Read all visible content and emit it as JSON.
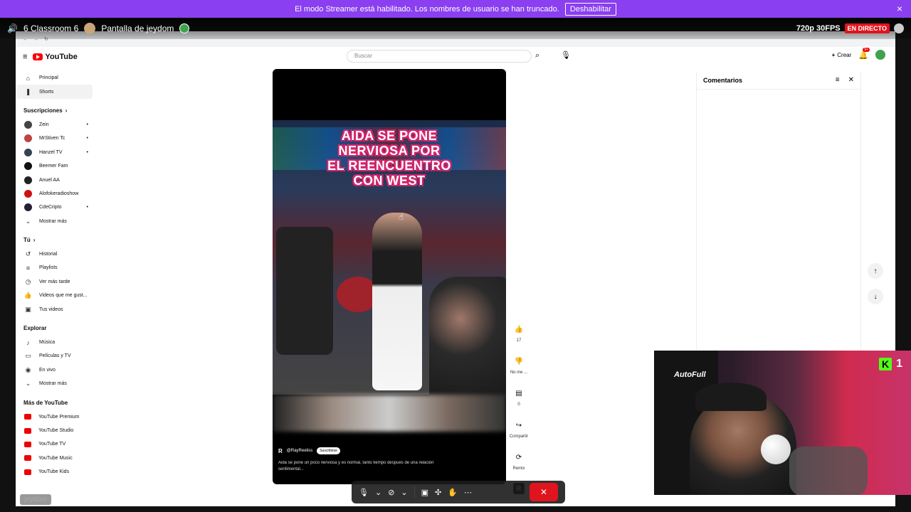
{
  "banner": {
    "message": "El modo Streamer está habilitado. Los nombres de usuario se han truncado.",
    "disable_label": "Deshabilitar",
    "close_icon": "×"
  },
  "stream": {
    "room": "6 Classroom 6",
    "screen_title": "Pantalla de jeydom",
    "quality": "720p 30FPS",
    "live_label": "EN DIRECTO"
  },
  "youtube": {
    "logo_text": "YouTube",
    "search_placeholder": "Buscar",
    "create_label": "Crear",
    "notif_count": "9+",
    "sidebar": {
      "top": [
        {
          "label": "Principal",
          "icon": "⌂"
        },
        {
          "label": "Shorts",
          "icon": "❚"
        }
      ],
      "subs_header": "Suscripciones",
      "subscriptions": [
        {
          "label": "Zein",
          "color": "#444"
        },
        {
          "label": "MrStiven Tc",
          "color": "#b44"
        },
        {
          "label": "Hanzel TV",
          "color": "#345"
        },
        {
          "label": "Beemer Fam",
          "color": "#111"
        },
        {
          "label": "Anuel AA",
          "color": "#222"
        },
        {
          "label": "Alofokeradioshow",
          "color": "#c11"
        },
        {
          "label": "CdeCripto",
          "color": "#223"
        }
      ],
      "show_more": "Mostrar más",
      "you_header": "Tú",
      "you_items": [
        {
          "label": "Historial",
          "icon": "↺"
        },
        {
          "label": "Playlists",
          "icon": "≡"
        },
        {
          "label": "Ver más tarde",
          "icon": "◷"
        },
        {
          "label": "Videos que me gust...",
          "icon": "👍"
        },
        {
          "label": "Tus videos",
          "icon": "▣"
        }
      ],
      "explore_header": "Explorar",
      "explore_items": [
        {
          "label": "Música",
          "icon": "♪"
        },
        {
          "label": "Películas y TV",
          "icon": "▭"
        },
        {
          "label": "En vivo",
          "icon": "◉"
        },
        {
          "label": "Mostrar más",
          "icon": "⌄"
        }
      ],
      "more_header": "Más de YouTube",
      "more_items": [
        {
          "label": "YouTube Premium"
        },
        {
          "label": "YouTube Studio"
        },
        {
          "label": "YouTube TV"
        },
        {
          "label": "YouTube Music"
        },
        {
          "label": "YouTube Kids"
        }
      ]
    },
    "short": {
      "overlay_lines": [
        "AIDA SE PONE",
        "NERVIOSA POR",
        "EL REENCUENTRO",
        "CON WEST"
      ],
      "channel": "@RayReeliss",
      "subscribe": "Suscribirse",
      "description": "Aida se pone un poco nerviosa y es normal, tanto tiempo después de una relación sentimental..."
    },
    "actions": {
      "likes": "17",
      "dislike": "No me ...",
      "comments": "0",
      "share": "Compartir",
      "remix": "Remix"
    },
    "comments_title": "Comentarios"
  },
  "cam": {
    "chair_brand": "AutoFull",
    "kick_count": "1"
  },
  "viewer_name": "jeydom"
}
